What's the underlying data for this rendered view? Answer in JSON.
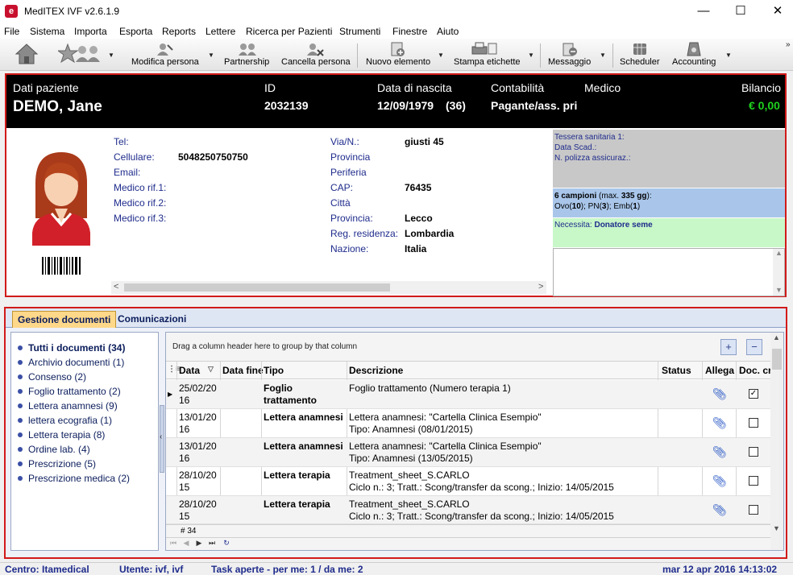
{
  "window": {
    "title": "MedITEX IVF v2.6.1.9",
    "minimize": "—",
    "maximize": "☐",
    "close": "✕"
  },
  "menu": [
    "File",
    "Sistema",
    "Importa",
    "Esporta",
    "Reports",
    "Lettere",
    "Ricerca per Pazienti",
    "Strumenti",
    "Finestre",
    "Aiuto"
  ],
  "toolbar": {
    "buttons": [
      {
        "label": "",
        "icon": "home-icon"
      },
      {
        "label": "",
        "icon": "people-icon"
      },
      {
        "label": "Modifica persona",
        "icon": "edit-person-icon"
      },
      {
        "label": "Partnership",
        "icon": "partnership-icon"
      },
      {
        "label": "Cancella persona",
        "icon": "delete-person-icon"
      },
      {
        "label": "Nuovo elemento",
        "icon": "new-element-icon"
      },
      {
        "label": "Stampa etichette",
        "icon": "print-labels-icon"
      },
      {
        "label": "Messaggio",
        "icon": "message-icon"
      },
      {
        "label": "Scheduler",
        "icon": "scheduler-icon"
      },
      {
        "label": "Accounting",
        "icon": "accounting-icon"
      }
    ],
    "overflow": "»"
  },
  "patient": {
    "labels": {
      "data": "Dati paziente",
      "id": "ID",
      "dob": "Data di nascita",
      "accounting": "Contabilità",
      "doctor": "Medico",
      "balance": "Bilancio"
    },
    "name": "DEMO, Jane",
    "id": "2032139",
    "dob": "12/09/1979",
    "age": "(36)",
    "accounting": "Pagante/ass. pri",
    "balance": "€ 0,00",
    "contact": [
      {
        "label": "Tel:",
        "value": ""
      },
      {
        "label": "Cellulare:",
        "value": "5048250750750"
      },
      {
        "label": "Email:",
        "value": ""
      },
      {
        "label": "Medico rif.1:",
        "value": ""
      },
      {
        "label": "Medico rif.2:",
        "value": ""
      },
      {
        "label": "Medico rif.3:",
        "value": ""
      }
    ],
    "address": [
      {
        "label": "Via/N.:",
        "value": "giusti 45"
      },
      {
        "label": "Provincia",
        "value": ""
      },
      {
        "label": "Periferia",
        "value": ""
      },
      {
        "label": "CAP:",
        "value": "76435"
      },
      {
        "label": "Città",
        "value": ""
      },
      {
        "label": "Provincia:",
        "value": "Lecco"
      },
      {
        "label": "Reg. residenza:",
        "value": "Lombardia"
      },
      {
        "label": "Nazione:",
        "value": "Italia"
      }
    ],
    "insurance": [
      "Tessera sanitaria 1:",
      "Data Scad.:",
      "N. polizza assicuraz.:"
    ],
    "samples_line1_bold": "6 campioni",
    "samples_line1_max_label": " (max. ",
    "samples_line1_max": "335 gg",
    "samples_line1_end": "):",
    "samples_line2_ovo": "Ovo(",
    "samples_line2_ovo_n": "10",
    "samples_line2_pn": "); PN(",
    "samples_line2_pn_n": "3",
    "samples_line2_emb": "); Emb(",
    "samples_line2_emb_n": "1",
    "samples_line2_end": ")",
    "needs_label": "Necessita: ",
    "needs_value": "Donatore seme"
  },
  "tabs": [
    "Gestione documenti",
    "Comunicazioni"
  ],
  "tree": [
    {
      "label": "Tutti i documenti (34)",
      "bold": true
    },
    {
      "label": "Archivio documenti (1)"
    },
    {
      "label": "Consenso (2)"
    },
    {
      "label": "Foglio trattamento (2)"
    },
    {
      "label": "Lettera anamnesi (9)"
    },
    {
      "label": "lettera ecografia (1)"
    },
    {
      "label": "Lettera terapia (8)"
    },
    {
      "label": "Ordine lab. (4)"
    },
    {
      "label": "Prescrizione (5)"
    },
    {
      "label": "Prescrizione medica (2)"
    }
  ],
  "grid": {
    "group_hint": "Drag a column header here to group by that column",
    "expand_btn": "+",
    "collapse_btn": "−",
    "columns": [
      "Data",
      "Data fine",
      "Tipo",
      "Descrizione",
      "Status",
      "Allega",
      "Doc. cr"
    ],
    "rows": [
      {
        "date1": "25/02/20",
        "date2": "16",
        "type1": "Foglio",
        "type2": "trattamento",
        "desc1": "Foglio trattamento  (Numero terapia 1)",
        "desc2": "",
        "checked": "✓",
        "selected": true
      },
      {
        "date1": "13/01/20",
        "date2": "16",
        "type1": "Lettera anamnesi",
        "type2": "",
        "desc1": "Lettera anamnesi: \"Cartella Clinica Esempio\"",
        "desc2": "Tipo: Anamnesi (08/01/2015)",
        "checked": ""
      },
      {
        "date1": "13/01/20",
        "date2": "16",
        "type1": "Lettera anamnesi",
        "type2": "",
        "desc1": "Lettera anamnesi: \"Cartella Clinica Esempio\"",
        "desc2": "Tipo: Anamnesi (13/05/2015)",
        "checked": ""
      },
      {
        "date1": "28/10/20",
        "date2": "15",
        "type1": "Lettera terapia",
        "type2": "",
        "desc1": "Treatment_sheet_S.CARLO",
        "desc2": "Ciclo n.: 3; Tratt.: Scong/transfer da scong.; Inizio:  14/05/2015",
        "checked": ""
      },
      {
        "date1": "28/10/20",
        "date2": "15",
        "type1": "Lettera terapia",
        "type2": "",
        "desc1": "Treatment_sheet_S.CARLO",
        "desc2": "Ciclo n.: 3; Tratt.: Scong/transfer da scong.; Inizio:  14/05/2015",
        "checked": ""
      }
    ],
    "count": "# 34"
  },
  "status": {
    "center": "Centro: Itamedical",
    "user": "Utente: ivf, ivf",
    "tasks": "Task aperte - per me: 1 / da me: 2",
    "datetime": "mar 12 apr 2016 14:13:02"
  },
  "colors": {
    "accent_red": "#d21a1a",
    "header_black": "#000000",
    "balance_green": "#1fd01f",
    "label_blue": "#1f2c8c"
  }
}
